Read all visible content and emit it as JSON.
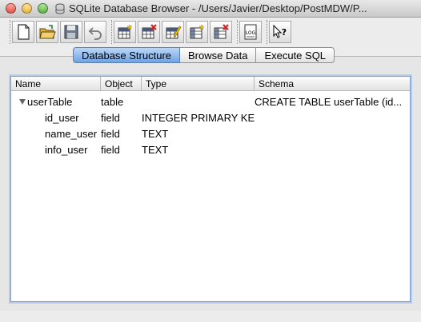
{
  "window": {
    "title": "SQLite Database Browser - /Users/Javier/Desktop/PostMDW/P..."
  },
  "toolbar": {
    "buttons": [
      {
        "icon": "new-document-icon"
      },
      {
        "icon": "open-folder-icon"
      },
      {
        "icon": "save-disk-icon"
      },
      {
        "icon": "undo-icon"
      },
      {
        "icon": "create-table-icon"
      },
      {
        "icon": "delete-table-icon"
      },
      {
        "icon": "modify-table-icon"
      },
      {
        "icon": "create-index-icon"
      },
      {
        "icon": "delete-index-icon"
      },
      {
        "icon": "log-icon"
      },
      {
        "icon": "whats-this-icon"
      }
    ]
  },
  "tabs": [
    {
      "label": "Database Structure",
      "active": true
    },
    {
      "label": "Browse Data",
      "active": false
    },
    {
      "label": "Execute SQL",
      "active": false
    }
  ],
  "tree": {
    "columns": [
      "Name",
      "Object",
      "Type",
      "Schema"
    ],
    "rows": [
      {
        "name": "userTable",
        "object": "table",
        "type": "",
        "schema": "CREATE TABLE userTable (id..."
      },
      {
        "name": "id_user",
        "object": "field",
        "type": "INTEGER PRIMARY KEY",
        "schema": ""
      },
      {
        "name": "name_user",
        "object": "field",
        "type": "TEXT",
        "schema": ""
      },
      {
        "name": "info_user",
        "object": "field",
        "type": "TEXT",
        "schema": ""
      }
    ]
  },
  "colors": {
    "active_tab": "#6fa3e4",
    "focus_ring": "#b7cdea"
  }
}
